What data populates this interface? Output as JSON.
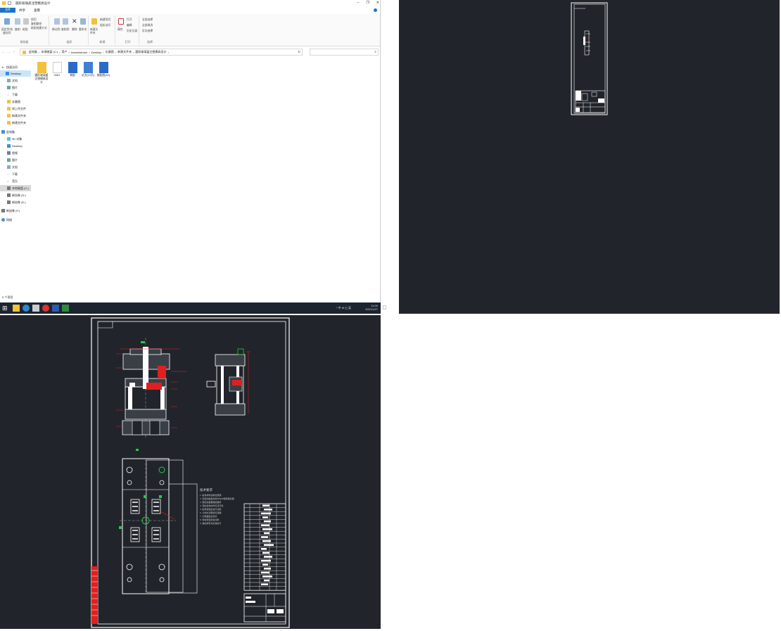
{
  "explorer": {
    "title": "圆形玻璃盖注塑模具设计",
    "tabs": [
      "文件",
      "主页",
      "共享",
      "查看"
    ],
    "ribbon": {
      "clipboard": {
        "label": "剪贴板",
        "pin": "固定到'快速访问'",
        "copy": "复制",
        "paste": "粘贴",
        "cut": "剪切",
        "copy_path": "复制路径",
        "paste_shortcut": "粘贴快捷方式"
      },
      "organize": {
        "label": "组织",
        "move_to": "移动到",
        "copy_to": "复制到",
        "delete": "删除",
        "rename": "重命名"
      },
      "new": {
        "label": "新建",
        "new_folder": "新建文件夹",
        "new_item": "新建项目",
        "easy_access": "轻松访问"
      },
      "open": {
        "label": "打开",
        "properties": "属性",
        "open": "打开",
        "edit": "编辑",
        "history": "历史记录"
      },
      "select": {
        "label": "选择",
        "select_all": "全部选择",
        "select_none": "全部取消",
        "invert": "反向选择"
      }
    },
    "breadcrumb": [
      "此电脑",
      "本地磁盘 (C:)",
      "用户",
      "Administrator",
      "Desktop",
      "长襄图",
      "新建文件夹",
      "圆形玻璃盖注塑模具设计"
    ],
    "nav": {
      "quick_access": "快速访问",
      "quick_items": [
        "Desktop",
        "文档",
        "图片",
        "下载",
        "长襄图",
        "线上传文件",
        "新建文件夹",
        "新建文件夹"
      ],
      "this_pc": "此电脑",
      "pc_items": [
        "3D 对象",
        "Desktop",
        "视频",
        "图片",
        "文档",
        "下载",
        "音乐",
        "本地磁盘 (C:)",
        "新加卷 (D:)",
        "新加卷 (E:)"
      ],
      "drive_f": "新加卷 (F:)",
      "network": "网络"
    },
    "files": [
      {
        "name": "圆形玻璃盖注塑模具设计",
        "type": "folder"
      },
      {
        "name": "0061",
        "type": "blank"
      },
      {
        "name": "装配",
        "type": "dwg"
      },
      {
        "name": "论文(12页)",
        "type": "doc"
      },
      {
        "name": "装配图(A1)",
        "type": "dwg"
      }
    ],
    "status": "5 个项目"
  },
  "taskbar": {
    "time": "11:00",
    "date": "2021/1/27",
    "tray": "^ 中 ⊕ ◫ 英"
  },
  "cad": {
    "notes_title": "技术要求",
    "notes": [
      "1. 模具材料选用优质钢",
      "2. 定模动模板材料均为45钢调质处理",
      "3. 型腔表面粗糙度要求",
      "4. 顶出机构动作灵活可靠",
      "5. 模具装配后进行试模",
      "6. 冷却水道畅通无泄漏",
      "7. 分型面贴合良好",
      "8. 导柱导套配合间隙",
      "9. 其余按有关标准执行"
    ]
  },
  "colors": {
    "cad_bg": "#21252b",
    "accent": "#1a73c8",
    "taskbar": "#1b2430",
    "cad_red": "#e02020",
    "cad_green": "#22cc44"
  }
}
